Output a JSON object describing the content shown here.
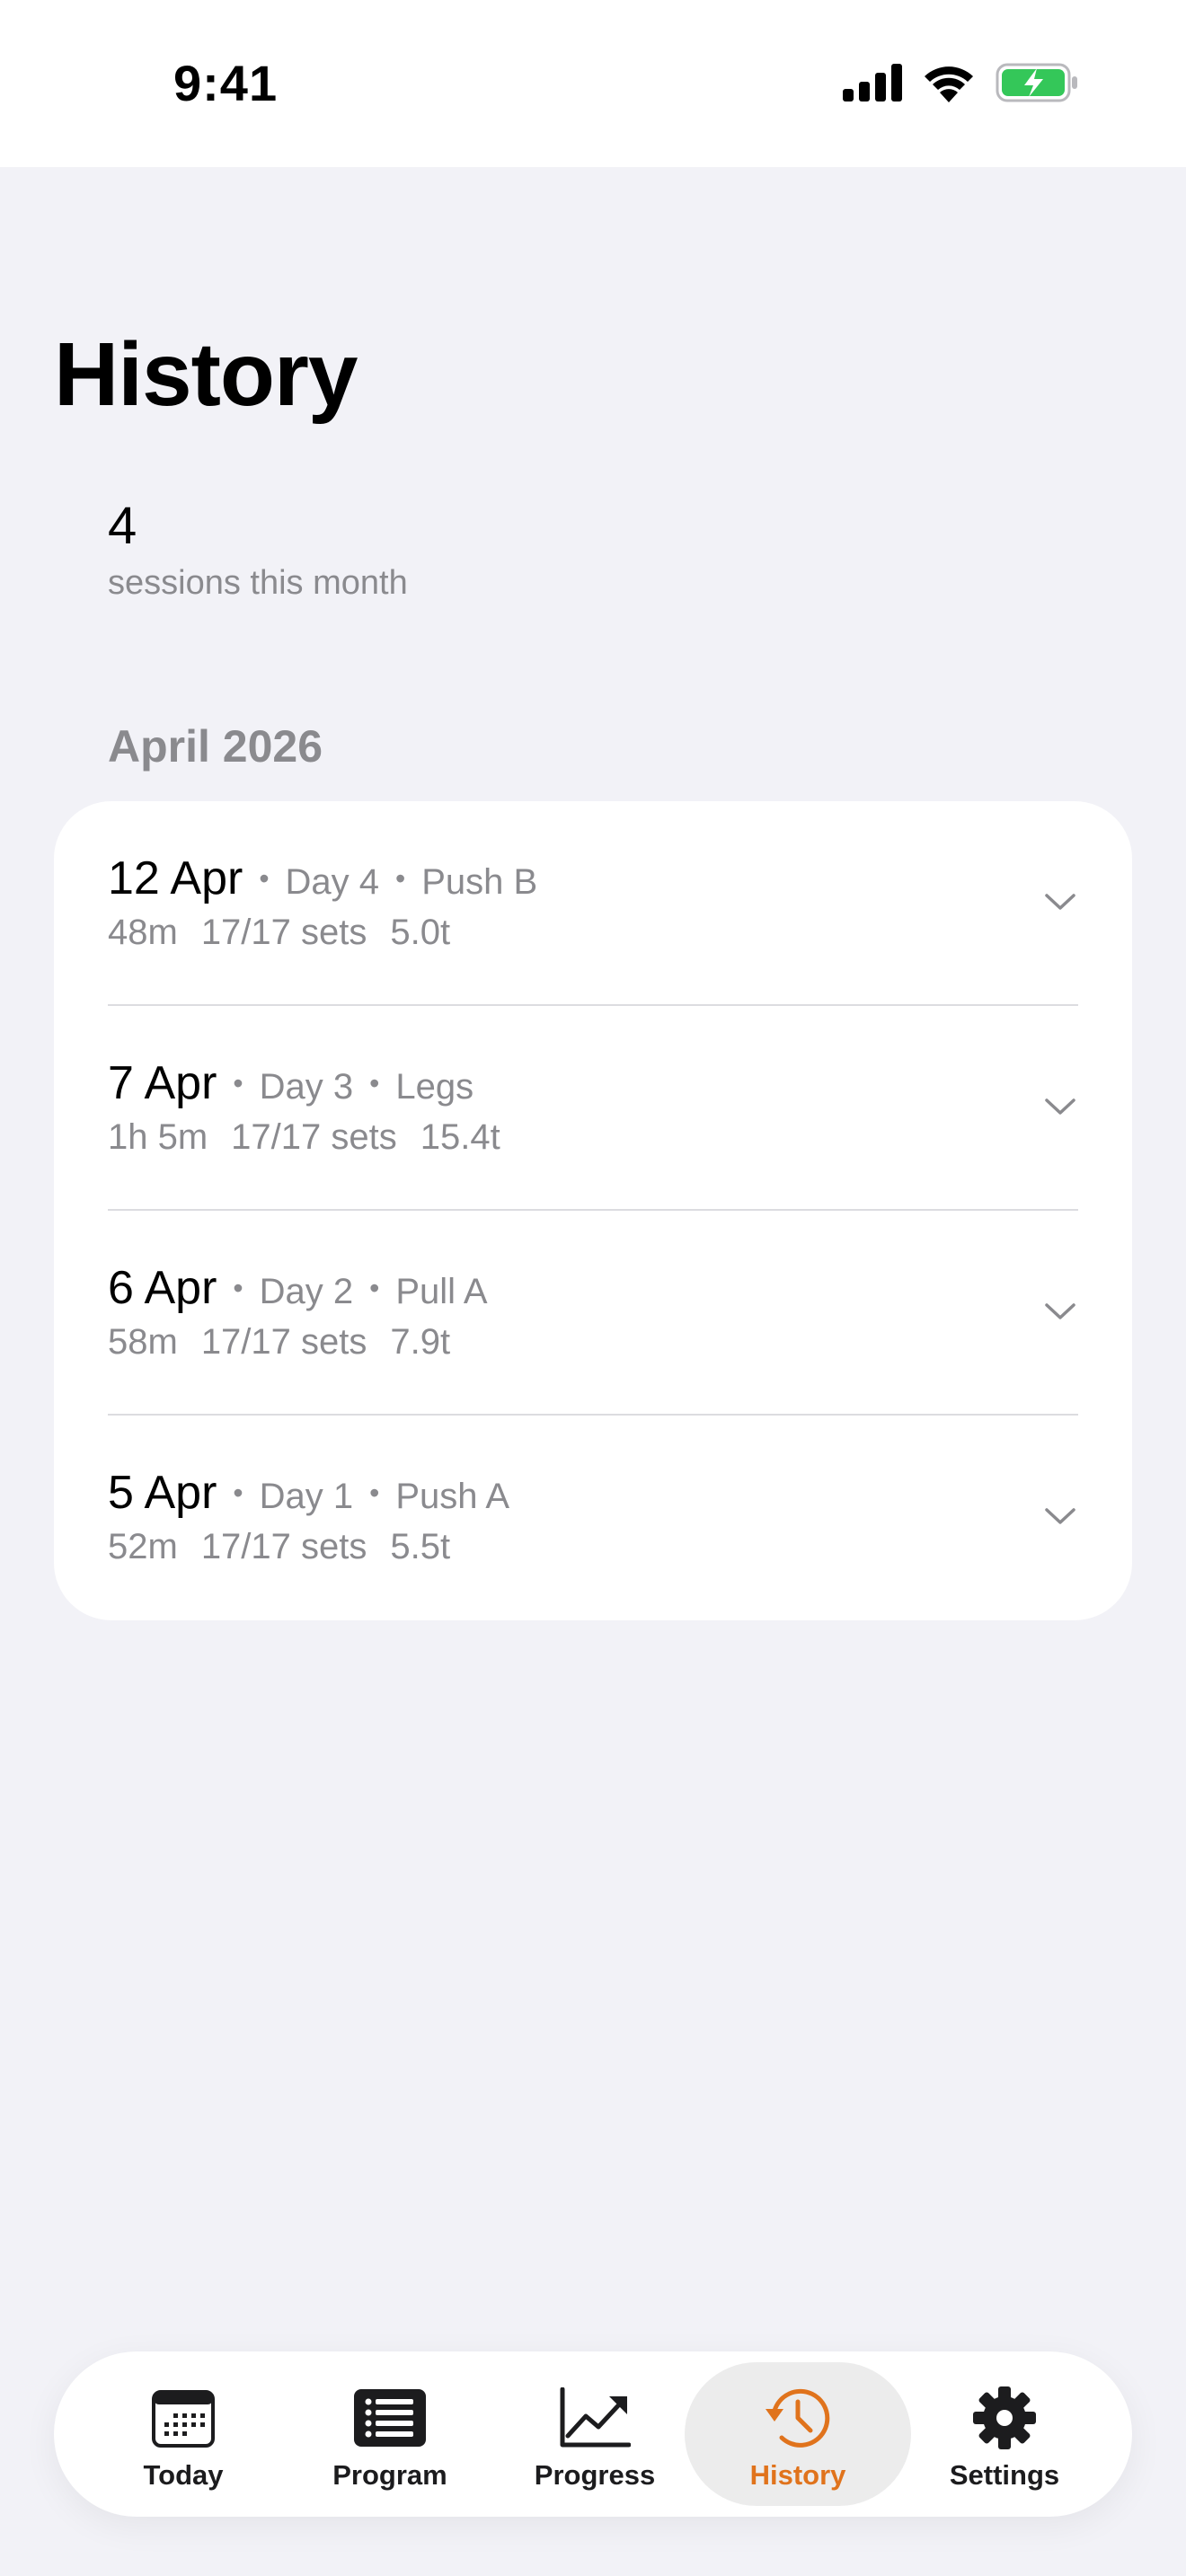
{
  "status_bar": {
    "time": "9:41",
    "battery_color": "#34c759"
  },
  "page": {
    "title": "History"
  },
  "summary": {
    "count": "4",
    "label": "sessions this month"
  },
  "month": {
    "header": "April 2026"
  },
  "sessions": [
    {
      "date": "12 Apr",
      "day": "Day 4",
      "workout": "Push B",
      "duration": "48m",
      "sets": "17/17 sets",
      "volume": "5.0t"
    },
    {
      "date": "7 Apr",
      "day": "Day 3",
      "workout": "Legs",
      "duration": "1h 5m",
      "sets": "17/17 sets",
      "volume": "15.4t"
    },
    {
      "date": "6 Apr",
      "day": "Day 2",
      "workout": "Pull A",
      "duration": "58m",
      "sets": "17/17 sets",
      "volume": "7.9t"
    },
    {
      "date": "5 Apr",
      "day": "Day 1",
      "workout": "Push A",
      "duration": "52m",
      "sets": "17/17 sets",
      "volume": "5.5t"
    }
  ],
  "separator": "•",
  "tab_bar": {
    "accent": "#e0731c",
    "tabs": [
      {
        "label": "Today",
        "icon": "calendar-icon"
      },
      {
        "label": "Program",
        "icon": "list-icon"
      },
      {
        "label": "Progress",
        "icon": "chart-line-icon"
      },
      {
        "label": "History",
        "icon": "history-clock-icon",
        "active": true
      },
      {
        "label": "Settings",
        "icon": "gear-icon"
      }
    ]
  }
}
